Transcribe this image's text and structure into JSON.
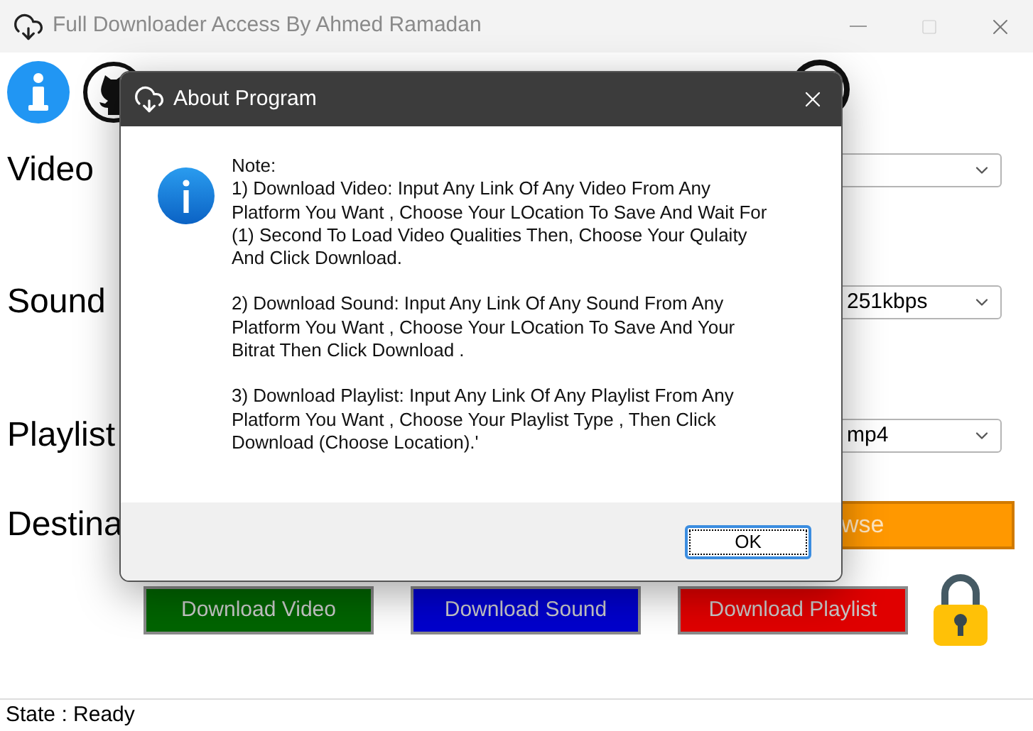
{
  "window": {
    "title": "Full Downloader Access By Ahmed Ramadan"
  },
  "rows": [
    {
      "label": "Video",
      "kind": "combo",
      "value": ""
    },
    {
      "label": "Sound",
      "kind": "combo",
      "value": "251kbps"
    },
    {
      "label": "Playlist",
      "kind": "combo",
      "value": "mp4"
    },
    {
      "label": "Destina",
      "kind": "button",
      "value": "wse"
    }
  ],
  "download_buttons": [
    {
      "label": "Download Video",
      "color": "#006400"
    },
    {
      "label": "Download Sound",
      "color": "#0000cd"
    },
    {
      "label": "Download Playlist",
      "color": "#e00000"
    }
  ],
  "status_bar": "State : Ready",
  "dialog": {
    "title": "About Program",
    "heading": "Note:",
    "paragraphs": [
      "1) Download Video: Input Any Link Of Any Video From Any Platform You Want , Choose Your LOcation To Save And Wait For (1) Second To Load Video Qualities Then, Choose Your Qulaity And Click Download.",
      "2) Download Sound: Input Any Link Of Any Sound From Any Platform You Want , Choose Your LOcation To Save And Your Bitrat Then Click Download .",
      "3) Download Playlist: Input Any Link Of Any Playlist From Any Platform You Want , Choose Your Playlist Type , Then Click Download  (Choose Location).'"
    ],
    "button": "OK"
  }
}
